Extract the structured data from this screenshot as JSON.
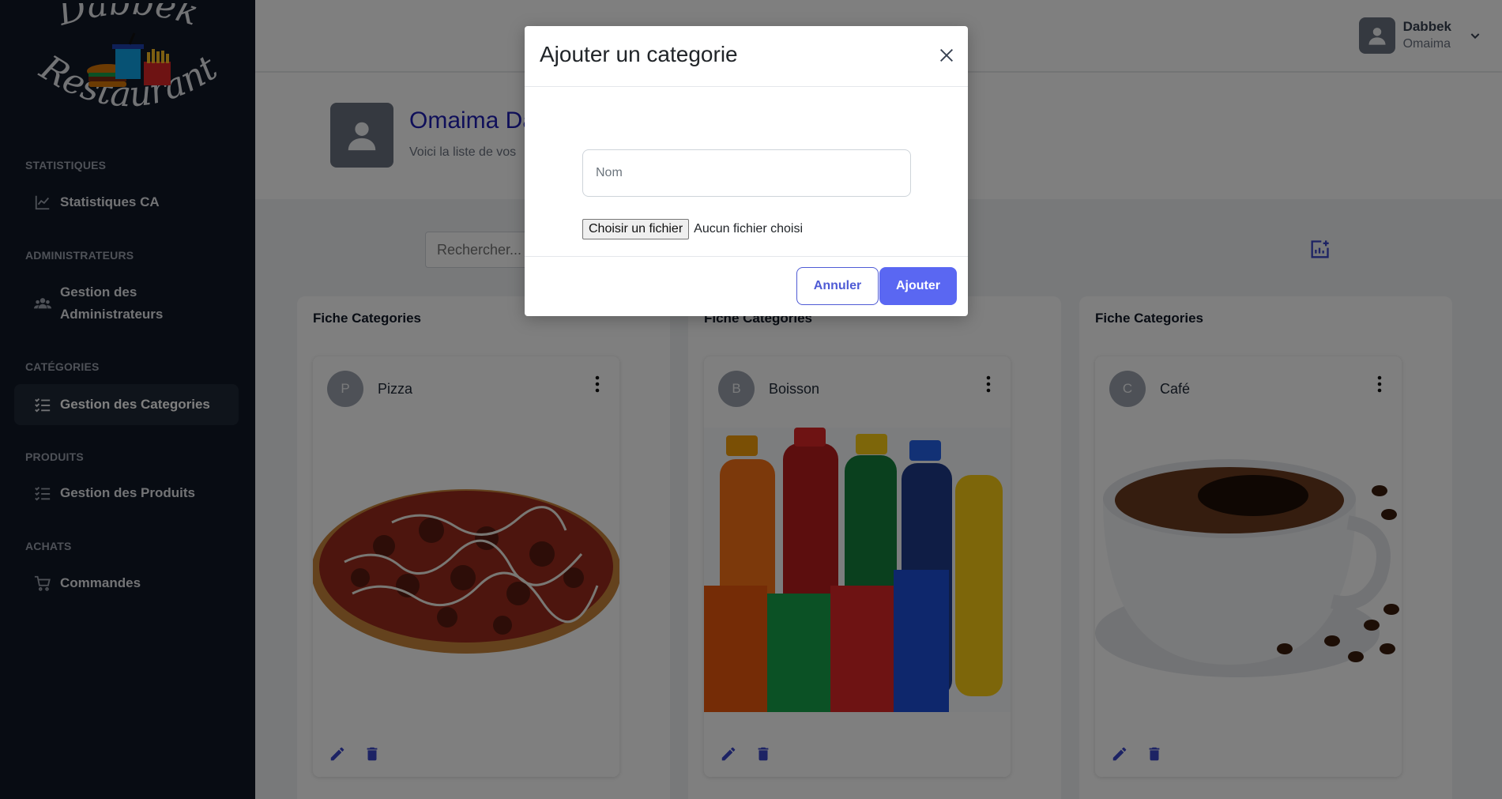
{
  "brand": {
    "logo_line1": "Dabbek",
    "logo_line2": "Restaurant"
  },
  "sidebar": {
    "sections": [
      {
        "title": "STATISTIQUES",
        "items": [
          {
            "label": "Statistiques CA",
            "icon": "chart-line-icon",
            "active": false
          }
        ]
      },
      {
        "title": "ADMINISTRATEURS",
        "items": [
          {
            "label": "Gestion des Administrateurs",
            "label_l1": "Gestion des",
            "label_l2": "Administrateurs",
            "icon": "users-icon",
            "active": false
          }
        ]
      },
      {
        "title": "CATÉGORIES",
        "items": [
          {
            "label": "Gestion des Categories",
            "icon": "list-check-icon",
            "active": true
          }
        ]
      },
      {
        "title": "PRODUITS",
        "items": [
          {
            "label": "Gestion des Produits",
            "icon": "list-check-icon",
            "active": false
          }
        ]
      },
      {
        "title": "ACHATS",
        "items": [
          {
            "label": "Commandes",
            "icon": "cart-icon",
            "active": false
          }
        ]
      }
    ]
  },
  "topbar": {
    "user_name": "Dabbek",
    "user_sub": "Omaima"
  },
  "header": {
    "greeting": "Omaima Da",
    "subtitle": "Voici la liste de vos"
  },
  "search": {
    "placeholder": "Rechercher..."
  },
  "panels": [
    {
      "title": "Fiche Categories",
      "letter": "P",
      "name": "Pizza"
    },
    {
      "title": "Fiche Categories",
      "letter": "B",
      "name": "Boisson"
    },
    {
      "title": "Fiche Categories",
      "letter": "C",
      "name": "Café"
    }
  ],
  "modal": {
    "title": "Ajouter un categorie",
    "name_placeholder": "Nom",
    "file_button": "Choisir un fichier",
    "file_status": "Aucun fichier choisi",
    "cancel": "Annuler",
    "submit": "Ajouter"
  },
  "colors": {
    "sidebar_bg": "#111827",
    "accent": "#5a67f2",
    "greeting": "#1e1eb4",
    "icon_blue": "#3b46c9"
  }
}
